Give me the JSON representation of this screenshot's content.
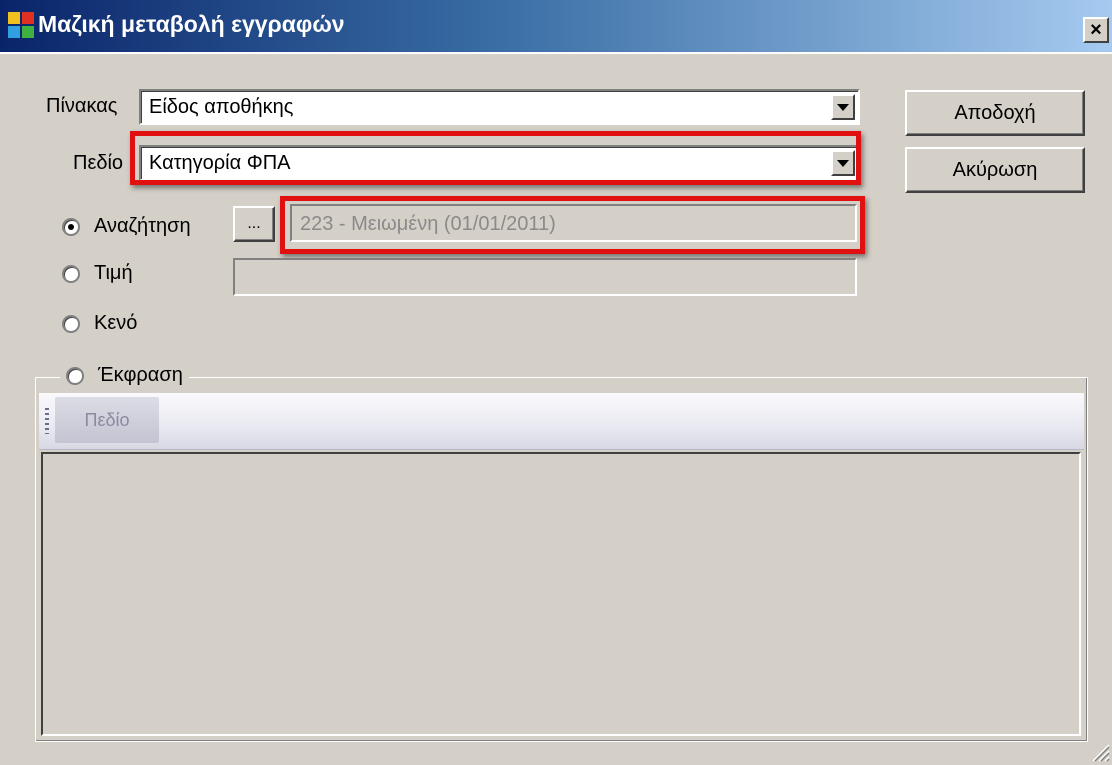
{
  "window": {
    "title": "Μαζική μεταβολή εγγραφών",
    "close_label": "×"
  },
  "form": {
    "table_label": "Πίνακας",
    "table_value": "Είδος αποθήκης",
    "field_label": "Πεδίο",
    "field_value": "Κατηγορία ΦΠΑ"
  },
  "buttons": {
    "accept": "Αποδοχή",
    "cancel": "Ακύρωση",
    "browse": "..."
  },
  "options": {
    "search_label": "Αναζήτηση",
    "search_value": "223 - Μειωμένη (01/01/2011)",
    "value_label": "Τιμή",
    "value_value": "",
    "empty_label": "Κενό",
    "expression_label": "Έκφραση",
    "selected": "search"
  },
  "expression": {
    "toolbar_field_button": "Πεδίο"
  },
  "colors": {
    "highlight": "#e01010",
    "window_bg": "#d4d0c8",
    "title_start": "#0a246a",
    "title_end": "#a6caf0"
  }
}
